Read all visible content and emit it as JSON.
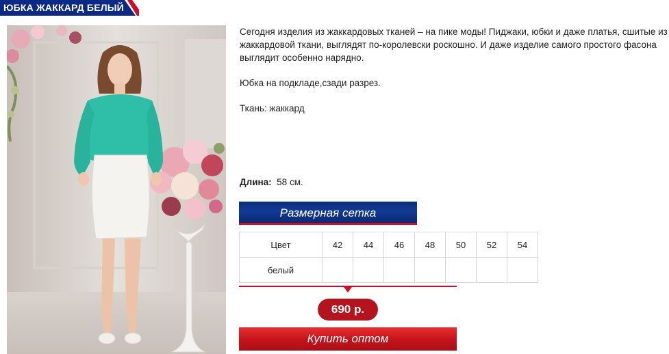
{
  "header": {
    "title": "ЮБКА ЖАККАРД БЕЛЫЙ",
    "colors": {
      "tab": "#0a2a85",
      "accent": "#c8102e"
    }
  },
  "product": {
    "description": [
      "Сегодня изделия из жаккардовых тканей – на пике моды! Пиджаки, юбки и даже платья, сшитые из жаккардовой ткани, выглядят по-королевски роскошно. И даже изделие самого простого фасона выглядит особенно нарядно.",
      "Юбка на подкладе,сзади разрез.",
      "Ткань: жаккард"
    ],
    "length_label": "Длина:",
    "length_value": "58 см."
  },
  "size_chart_button": "Размерная сетка",
  "size_table": {
    "header_label": "Цвет",
    "sizes": [
      "42",
      "44",
      "46",
      "48",
      "50",
      "52",
      "54"
    ],
    "rows": [
      {
        "color": "белый",
        "cells": [
          "",
          "",
          "",
          "",
          "",
          "",
          ""
        ]
      }
    ]
  },
  "price": "690 р.",
  "buy_button": "Купить оптом"
}
